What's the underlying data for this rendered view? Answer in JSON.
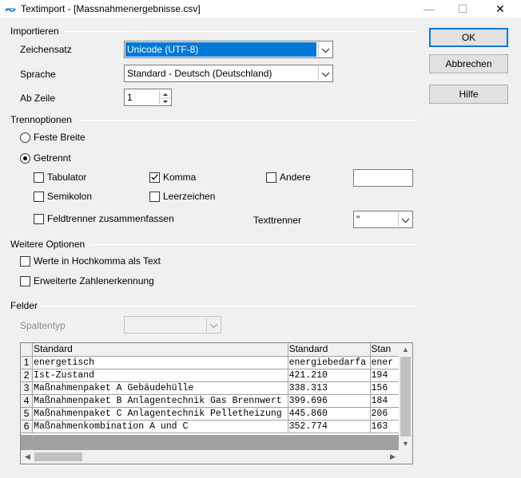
{
  "window": {
    "title": "Textimport - [Massnahmenergebnisse.csv]",
    "controls": {
      "minimize": "—",
      "maximize": "☐",
      "close": "✕"
    }
  },
  "buttons": {
    "ok": "OK",
    "cancel": "Abbrechen",
    "help": "Hilfe"
  },
  "import": {
    "section": "Importieren",
    "charset_label": "Zeichensatz",
    "charset_value": "Unicode (UTF-8)",
    "language_label": "Sprache",
    "language_value": "Standard - Deutsch (Deutschland)",
    "from_row_label": "Ab Zeile",
    "from_row_value": "1"
  },
  "separator": {
    "section": "Trennoptionen",
    "fixed_width": "Feste Breite",
    "separated": "Getrennt",
    "tab": "Tabulator",
    "comma": "Komma",
    "other": "Andere",
    "semicolon": "Semikolon",
    "space": "Leerzeichen",
    "merge": "Feldtrenner zusammenfassen",
    "text_delimiter_label": "Texttrenner",
    "text_delimiter_value": "\"",
    "other_value": ""
  },
  "other_options": {
    "section": "Weitere Optionen",
    "quoted_as_text": "Werte in Hochkomma als Text",
    "detect_special_numbers": "Erweiterte Zahlenerkennung"
  },
  "fields": {
    "section": "Felder",
    "column_type_label": "Spaltentyp",
    "column_type_value": ""
  },
  "preview": {
    "headers": [
      "",
      "Standard",
      "Standard",
      "Stan"
    ],
    "rows": [
      [
        "1",
        "energetisch",
        "energiebedarfa",
        "ener"
      ],
      [
        "2",
        "Ist-Zustand",
        "421.210",
        "194"
      ],
      [
        "3",
        "Maßnahmenpaket A Gebäudehülle",
        "338.313",
        "156"
      ],
      [
        "4",
        "Maßnahmenpaket B Anlagentechnik Gas Brennwert",
        "399.696",
        "184"
      ],
      [
        "5",
        "Maßnahmenpaket C Anlagentechnik Pelletheizung",
        "445.860",
        "206"
      ],
      [
        "6",
        "Maßnahmenkombination A und C",
        "352.774",
        "163"
      ]
    ]
  }
}
